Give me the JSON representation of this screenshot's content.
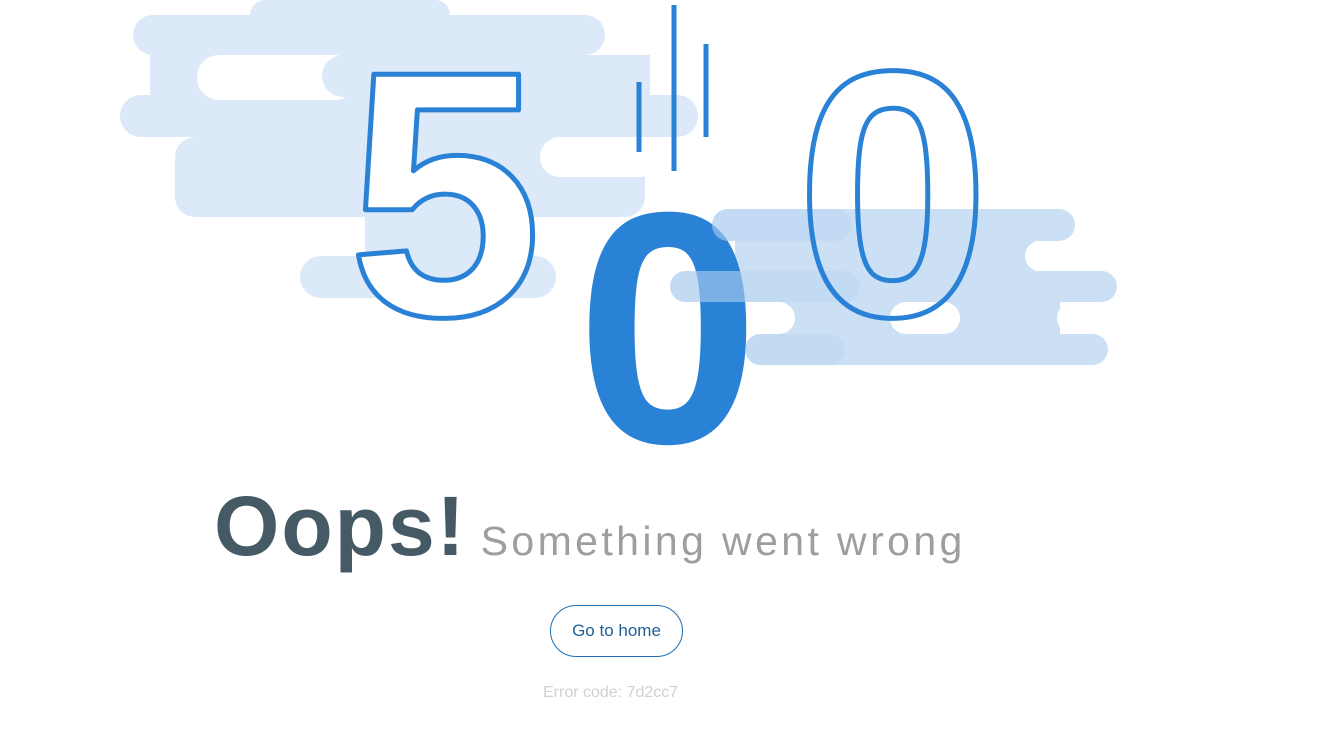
{
  "illustration": {
    "digits": [
      "5",
      "0",
      "0"
    ],
    "colors": {
      "primary": "#2a82d6",
      "cloud_light": "#dbe9f8",
      "cloud_mid": "#bcd6f2"
    }
  },
  "headline": {
    "title": "Oops!",
    "subtitle": "Something went wrong"
  },
  "actions": {
    "home_label": "Go to home"
  },
  "footer": {
    "error_code": "Error code: 7d2cc7"
  },
  "colors": {
    "title": "#455a64",
    "subtitle": "#9e9e9e",
    "button_border": "#1e6fb5",
    "button_text": "#1e5f99",
    "error_code": "#d0d0d0"
  }
}
